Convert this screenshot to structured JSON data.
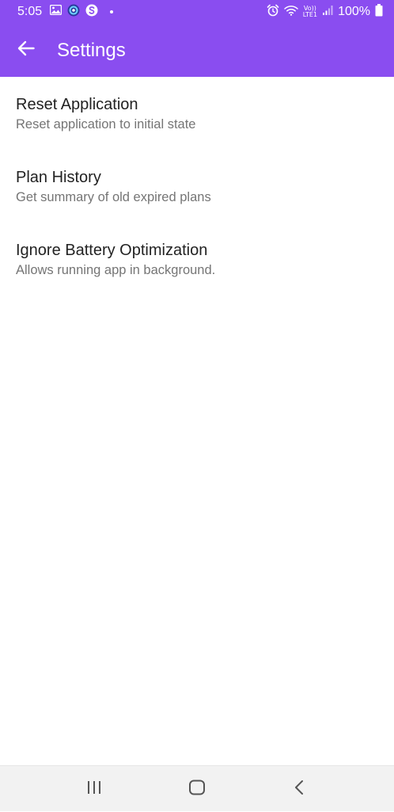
{
  "status_bar": {
    "time": "5:05",
    "network_label_top": "Vo))",
    "network_label_bottom": "LTE1",
    "battery": "100%",
    "icons": [
      "image-icon",
      "browser-icon",
      "skype-icon",
      "alarm-icon",
      "wifi-icon",
      "signal-icon",
      "battery-icon"
    ]
  },
  "app_bar": {
    "title": "Settings",
    "back_icon": "arrow-left-icon",
    "color": "#8a4df0"
  },
  "settings": [
    {
      "title": "Reset Application",
      "subtitle": "Reset application to initial state"
    },
    {
      "title": "Plan History",
      "subtitle": "Get summary of old expired plans"
    },
    {
      "title": "Ignore Battery Optimization",
      "subtitle": "Allows running app in background."
    }
  ],
  "nav_bar": {
    "icons": [
      "recent-apps-icon",
      "home-icon",
      "back-icon"
    ]
  }
}
